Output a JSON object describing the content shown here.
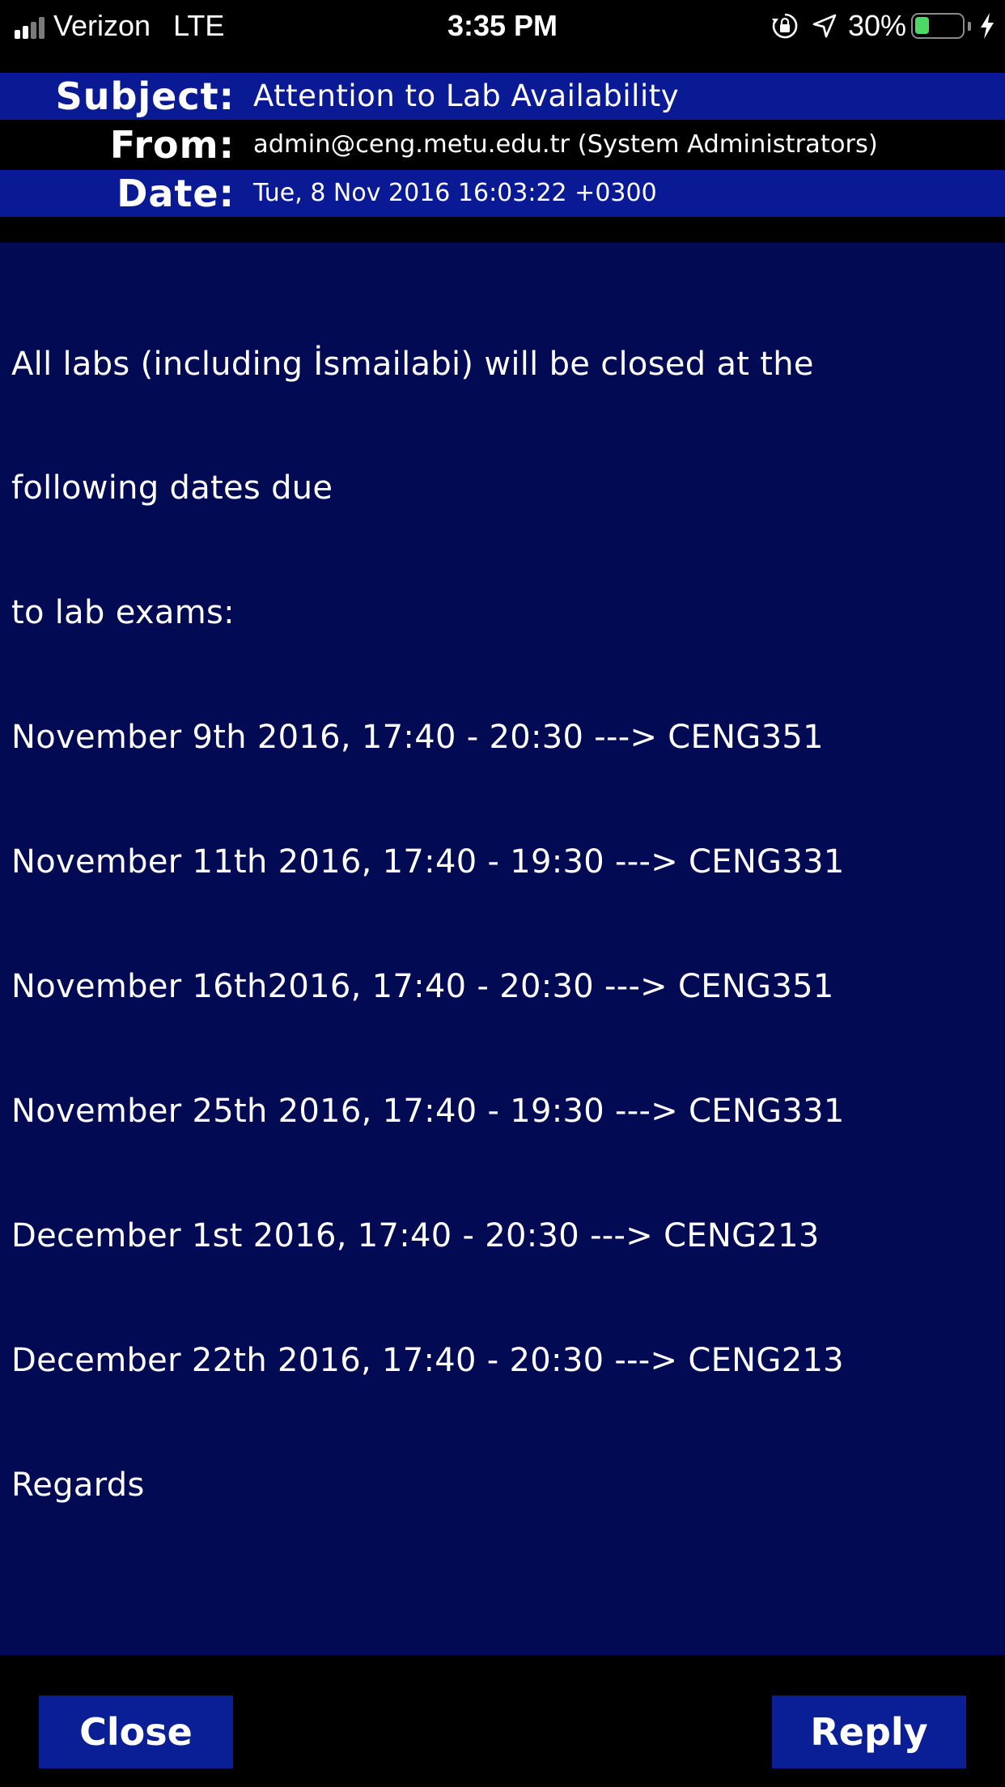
{
  "status_bar": {
    "carrier": "Verizon",
    "network": "LTE",
    "time": "3:35 PM",
    "battery_percent": "30%",
    "battery_level": 0.3,
    "icons": [
      "signal-bars-icon",
      "orientation-lock-icon",
      "location-arrow-icon",
      "battery-icon",
      "charging-bolt-icon"
    ]
  },
  "message": {
    "subject_label": "Subject:",
    "subject": "Attention to Lab Availability",
    "from_label": "From:",
    "from": "admin@ceng.metu.edu.tr (System Administrators)",
    "date_label": "Date:",
    "date": "Tue, 8 Nov 2016 16:03:22 +0300",
    "body_lines": [
      "All labs (including İsmailabi) will be closed at the",
      "following dates due",
      "to lab exams:",
      "November 9th 2016, 17:40 - 20:30 ---> CENG351",
      "November 11th 2016, 17:40 - 19:30 ---> CENG331",
      "November 16th2016, 17:40 - 20:30 ---> CENG351",
      "November 25th 2016, 17:40 - 19:30 ---> CENG331",
      "December 1st 2016, 17:40 - 20:30 ---> CENG213",
      "December 22th 2016, 17:40 - 20:30 ---> CENG213",
      "Regards"
    ]
  },
  "footer": {
    "close_label": "Close",
    "reply_label": "Reply"
  },
  "colors": {
    "header_blue": "#0a1a94",
    "body_background": "#010a52",
    "button_blue": "#0a1f96",
    "battery_green": "#4cd964"
  }
}
